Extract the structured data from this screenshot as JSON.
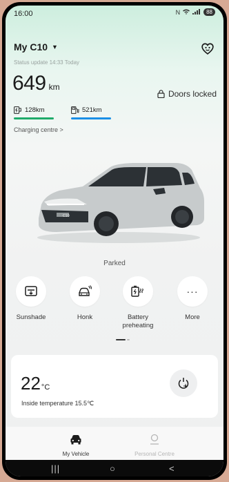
{
  "status_bar": {
    "time": "16:00",
    "battery": "88"
  },
  "header": {
    "vehicle_name": "My C10",
    "status_update": "Status update 14:33 Today"
  },
  "range": {
    "total_value": "649",
    "total_unit": "km",
    "battery_range": "128km",
    "fuel_range": "521km",
    "battery_bar_color": "#1faa6a",
    "fuel_bar_color": "#1a8fe6",
    "charging_link": "Charging centre >"
  },
  "doors": {
    "label": "Doors locked"
  },
  "vehicle": {
    "state": "Parked",
    "badge": "C10"
  },
  "quick_actions": [
    {
      "label": "Sunshade",
      "icon": "sunshade-icon"
    },
    {
      "label": "Honk",
      "icon": "honk-icon"
    },
    {
      "label": "Battery preheating",
      "icon": "battery-preheat-icon"
    },
    {
      "label": "More",
      "icon": "more-icon"
    }
  ],
  "climate": {
    "temp_value": "22",
    "temp_unit": "°C",
    "inside_label": "Inside temperature 15.5℃"
  },
  "bottom_nav": [
    {
      "label": "My Vehicle",
      "active": true
    },
    {
      "label": "Personal Centre",
      "active": false
    }
  ]
}
